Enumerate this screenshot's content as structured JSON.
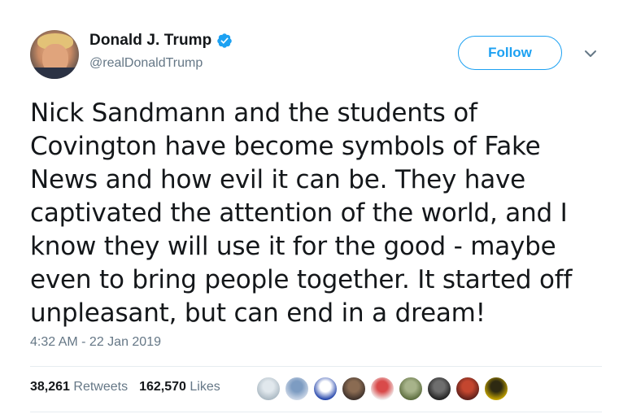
{
  "author": {
    "display_name": "Donald J. Trump",
    "handle": "@realDonaldTrump",
    "verified_icon": "verified-badge-icon",
    "verified_color": "#1da1f2"
  },
  "follow_button": {
    "label": "Follow"
  },
  "tweet": {
    "text": "Nick Sandmann and the students of\nCovington have become symbols of Fake\nNews and how evil it can be. They have\ncaptivated the attention of the world, and I\nknow they will use it for the good - maybe\neven to bring people together. It started off\nunpleasant, but can end in a dream!",
    "timestamp": "4:32 AM - 22 Jan 2019"
  },
  "stats": {
    "retweets_count": "38,261",
    "retweets_label": "Retweets",
    "likes_count": "162,570",
    "likes_label": "Likes"
  },
  "likers": [
    {
      "name": "liker-avatar-1",
      "colors": [
        "#aab8c2",
        "#e1e8ed"
      ]
    },
    {
      "name": "liker-avatar-2",
      "colors": [
        "#cfd9e8",
        "#7d9cc2"
      ]
    },
    {
      "name": "liker-avatar-3",
      "colors": [
        "#1d3fa8",
        "#ffffff"
      ]
    },
    {
      "name": "liker-avatar-4",
      "colors": [
        "#3b2f2a",
        "#8a6b52"
      ]
    },
    {
      "name": "liker-avatar-5",
      "colors": [
        "#f3f3f3",
        "#d94a4a"
      ]
    },
    {
      "name": "liker-avatar-6",
      "colors": [
        "#5a6b3c",
        "#a7b38a"
      ]
    },
    {
      "name": "liker-avatar-7",
      "colors": [
        "#1f1f1f",
        "#6e6e6e"
      ]
    },
    {
      "name": "liker-avatar-8",
      "colors": [
        "#5a1f1a",
        "#c4462f"
      ]
    },
    {
      "name": "liker-avatar-9",
      "colors": [
        "#c9a800",
        "#2e2a12"
      ]
    }
  ],
  "colors": {
    "accent": "#1da1f2",
    "text_primary": "#14171a",
    "text_secondary": "#657786",
    "divider": "#e6ecf0"
  }
}
